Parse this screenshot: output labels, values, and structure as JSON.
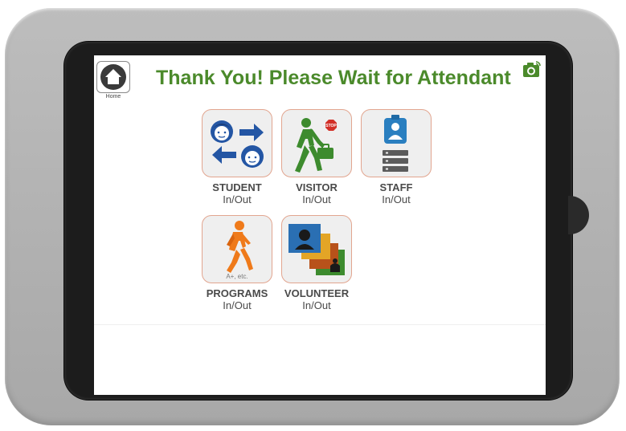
{
  "header": {
    "home_label": "Home",
    "title": "Thank You! Please Wait for Attendant"
  },
  "tiles": [
    {
      "name": "STUDENT",
      "sub": "In/Out"
    },
    {
      "name": "VISITOR",
      "sub": "In/Out"
    },
    {
      "name": "STAFF",
      "sub": "In/Out"
    },
    {
      "name": "PROGRAMS",
      "sub": "In/Out",
      "caption": "A+, etc."
    },
    {
      "name": "VOLUNTEER",
      "sub": "In/Out"
    }
  ],
  "visitor_sign": "STOP",
  "colors": {
    "accent_green": "#4b8a2b",
    "student_blue": "#2456a4",
    "visitor_green": "#3d8b2e",
    "staff_blue": "#2a7fc0",
    "programs_orange": "#ef7a1a",
    "tile_border": "#e2a58f"
  },
  "icons": {
    "home": "home-icon",
    "camera": "camera-icon",
    "student": "student-swap-icon",
    "visitor": "visitor-walking-icon",
    "staff": "staff-badge-icon",
    "programs": "programs-walker-icon",
    "volunteer": "volunteer-stack-icon"
  }
}
